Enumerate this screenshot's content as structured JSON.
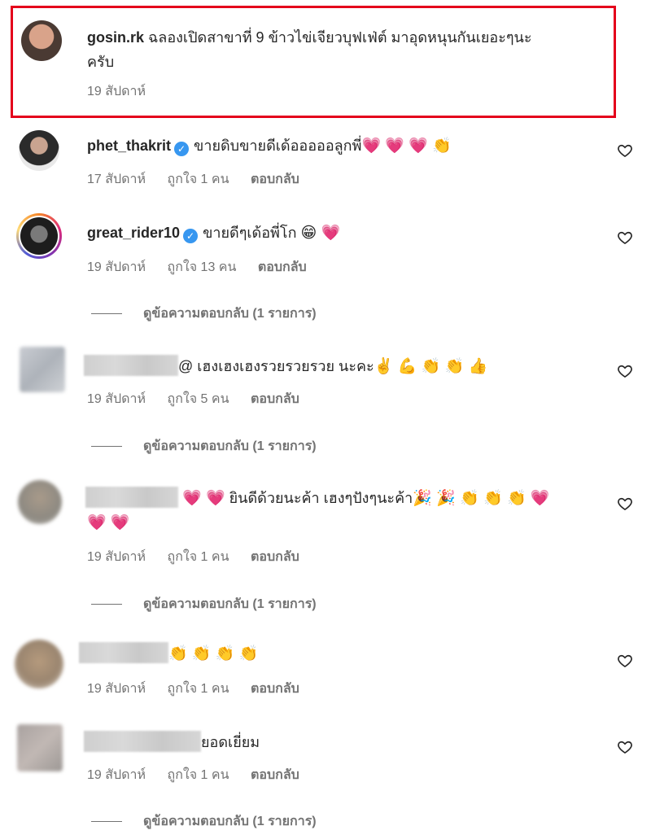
{
  "highlight_color": "#e4001b",
  "comments": [
    {
      "username": "gosin.rk",
      "text": "ฉลองเปิดสาขาที่ 9 ข้าวไข่เจียวบุฟเฟ่ต์ มาอุดหนุนกันเยอะๆนะ",
      "text_line2": "ครับ",
      "time": "19 สัปดาห์",
      "highlighted": true
    },
    {
      "username": "phet_thakrit",
      "verified": true,
      "text": "ขายดิบขายดีเด้อออออลูกพี่",
      "emojis": "💗 💗 💗 👏",
      "time": "17 สัปดาห์",
      "likes": "ถูกใจ 1 คน",
      "reply": "ตอบกลับ"
    },
    {
      "username": "great_rider10",
      "verified": true,
      "text": "ขายดีๆเด้อพี่โก",
      "emojis": "😁 💗",
      "time": "19 สัปดาห์",
      "likes": "ถูกใจ 13 คน",
      "reply": "ตอบกลับ",
      "view_replies": "ดูข้อความตอบกลับ (1 รายการ)"
    },
    {
      "text": "@ เฮงเฮงเฮงรวยรวยรวย นะคะ",
      "emojis": "✌️ 💪 👏 👏 👍",
      "time": "19 สัปดาห์",
      "likes": "ถูกใจ 5 คน",
      "reply": "ตอบกลับ",
      "view_replies": "ดูข้อความตอบกลับ (1 รายการ)"
    },
    {
      "emojis_pre": "💗 💗",
      "text": "ยินดีด้วยนะค้า เฮงๆปังๆนะค้า",
      "emojis": "🎉 🎉 👏 👏 👏 💗",
      "emojis_line2": "💗 💗",
      "time": "19 สัปดาห์",
      "likes": "ถูกใจ 1 คน",
      "reply": "ตอบกลับ",
      "view_replies": "ดูข้อความตอบกลับ (1 รายการ)"
    },
    {
      "emojis": "👏 👏 👏 👏",
      "time": "19 สัปดาห์",
      "likes": "ถูกใจ 1 คน",
      "reply": "ตอบกลับ"
    },
    {
      "text": "ยอดเยี่ยม",
      "time": "19 สัปดาห์",
      "likes": "ถูกใจ 1 คน",
      "reply": "ตอบกลับ",
      "view_replies": "ดูข้อความตอบกลับ (1 รายการ)"
    }
  ]
}
